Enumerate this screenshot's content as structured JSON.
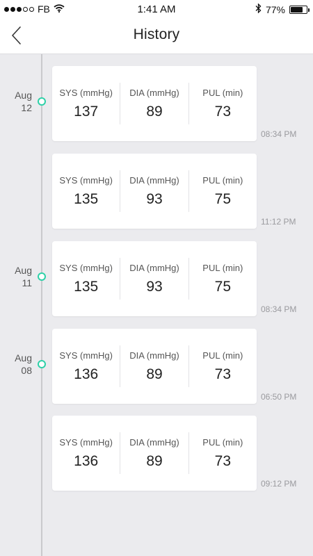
{
  "status_bar": {
    "carrier": "FB",
    "time": "1:41 AM",
    "battery_percent": "77%",
    "battery_level": 0.77,
    "signal_bars": 3,
    "signal_total": 5,
    "icons": [
      "wifi-icon",
      "bluetooth-icon",
      "battery-icon"
    ]
  },
  "nav": {
    "title": "History",
    "back_icon": "chevron-left-icon"
  },
  "colors": {
    "accent": "#2ed1a8",
    "background": "#ebebee",
    "card": "#ffffff"
  },
  "entries": [
    {
      "date_month": "Aug",
      "date_day": "12",
      "show_date": true,
      "sys_label": "SYS (mmHg)",
      "sys_value": "137",
      "dia_label": "DIA (mmHg)",
      "dia_value": "89",
      "pul_label": "PUL (min)",
      "pul_value": "73",
      "time": "08:34 PM"
    },
    {
      "date_month": "",
      "date_day": "",
      "show_date": false,
      "sys_label": "SYS (mmHg)",
      "sys_value": "135",
      "dia_label": "DIA (mmHg)",
      "dia_value": "93",
      "pul_label": "PUL (min)",
      "pul_value": "75",
      "time": "11:12 PM"
    },
    {
      "date_month": "Aug",
      "date_day": "11",
      "show_date": true,
      "sys_label": "SYS (mmHg)",
      "sys_value": "135",
      "dia_label": "DIA (mmHg)",
      "dia_value": "93",
      "pul_label": "PUL (min)",
      "pul_value": "75",
      "time": "08:34 PM"
    },
    {
      "date_month": "Aug",
      "date_day": "08",
      "show_date": true,
      "sys_label": "SYS (mmHg)",
      "sys_value": "136",
      "dia_label": "DIA (mmHg)",
      "dia_value": "89",
      "pul_label": "PUL (min)",
      "pul_value": "73",
      "time": "06:50 PM"
    },
    {
      "date_month": "",
      "date_day": "",
      "show_date": false,
      "sys_label": "SYS (mmHg)",
      "sys_value": "136",
      "dia_label": "DIA (mmHg)",
      "dia_value": "89",
      "pul_label": "PUL (min)",
      "pul_value": "73",
      "time": "09:12 PM"
    }
  ]
}
